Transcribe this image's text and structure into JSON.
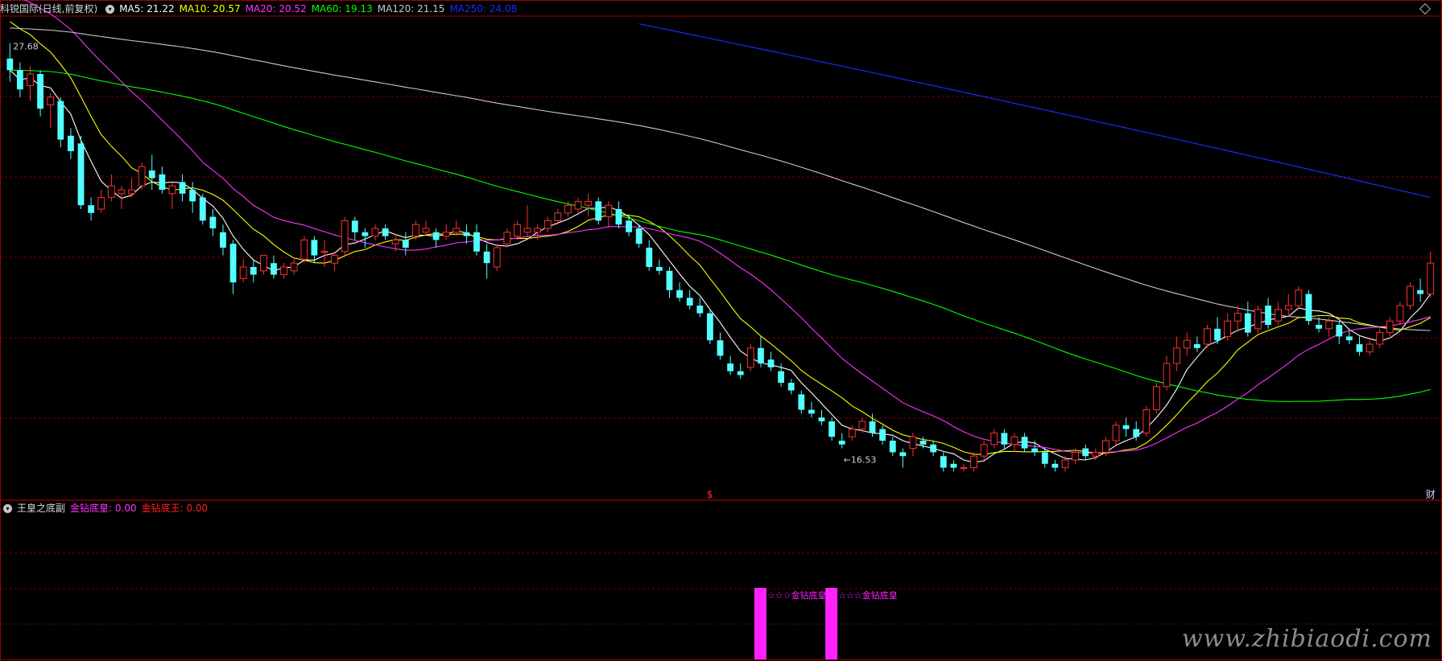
{
  "main_header": {
    "title": "科锐国际(日线,前复权)",
    "ma_labels": [
      {
        "text": "MA5: 21.22",
        "color": "#ffffff"
      },
      {
        "text": "MA10: 20.57",
        "color": "#ffff00"
      },
      {
        "text": "MA20: 20.52",
        "color": "#ff33ff"
      },
      {
        "text": "MA60: 19.13",
        "color": "#00ff00"
      },
      {
        "text": "MA120: 21.15",
        "color": "#c8c8c8"
      },
      {
        "text": "MA250: 24.08",
        "color": "#1a2cff"
      }
    ]
  },
  "sub_header": {
    "title": "王皇之底副",
    "items": [
      {
        "text": "金钻底皇: 0.00",
        "color": "#ff33ff"
      },
      {
        "text": "金钻底王: 0.00",
        "color": "#ff2020"
      }
    ]
  },
  "annotations": {
    "high_label": "27.68",
    "low_label": "←16.53",
    "marker_s": "$",
    "marker_cai": "财",
    "signal_label_1": "☆☆☆金钻底皇",
    "signal_label_2": "☆☆☆金钻底皇"
  },
  "watermark": "www.zhibiaodi.com",
  "colors": {
    "up": "#ff3030",
    "down": "#54ffff",
    "grid": "#7a0000",
    "border": "#a00000",
    "ma5": "#ffffff",
    "ma10": "#ffff00",
    "ma20": "#ff33ff",
    "ma60": "#00ff00",
    "ma120": "#c8c8c8",
    "ma250": "#1a2cff",
    "signal": "#ff22ff"
  },
  "chart_data": {
    "type": "candlestick",
    "title": "科锐国际(日线,前复权)",
    "price_range": [
      15.8,
      28.3
    ],
    "high": 27.68,
    "low": 16.53,
    "candles": [
      [
        27.2,
        27.6,
        26.6,
        26.9
      ],
      [
        26.9,
        27.1,
        26.2,
        26.4
      ],
      [
        26.5,
        27.0,
        26.1,
        26.8
      ],
      [
        26.8,
        26.9,
        25.7,
        25.9
      ],
      [
        26.0,
        26.3,
        25.4,
        26.2
      ],
      [
        26.1,
        26.2,
        24.9,
        25.1
      ],
      [
        25.2,
        25.4,
        24.6,
        24.8
      ],
      [
        25.0,
        25.2,
        23.3,
        23.4
      ],
      [
        23.4,
        23.6,
        23.0,
        23.2
      ],
      [
        23.3,
        23.8,
        23.2,
        23.6
      ],
      [
        23.6,
        24.2,
        23.5,
        23.9
      ],
      [
        23.7,
        23.9,
        23.3,
        23.8
      ],
      [
        23.7,
        24.1,
        23.6,
        23.8
      ],
      [
        23.9,
        24.5,
        23.8,
        24.4
      ],
      [
        24.3,
        24.7,
        23.8,
        24.1
      ],
      [
        24.2,
        24.4,
        23.7,
        23.8
      ],
      [
        23.7,
        24.0,
        23.3,
        23.9
      ],
      [
        24.0,
        24.2,
        23.5,
        23.7
      ],
      [
        23.8,
        24.0,
        23.2,
        23.5
      ],
      [
        23.6,
        23.7,
        22.9,
        23.0
      ],
      [
        23.1,
        23.3,
        22.6,
        22.8
      ],
      [
        22.7,
        22.9,
        22.1,
        22.3
      ],
      [
        22.4,
        22.5,
        21.1,
        21.4
      ],
      [
        21.5,
        22.0,
        21.4,
        21.8
      ],
      [
        21.8,
        22.0,
        21.4,
        21.6
      ],
      [
        21.7,
        22.1,
        21.6,
        22.1
      ],
      [
        21.9,
        22.1,
        21.5,
        21.6
      ],
      [
        21.6,
        21.9,
        21.5,
        21.8
      ],
      [
        21.7,
        22.0,
        21.6,
        21.9
      ],
      [
        22.0,
        22.6,
        21.9,
        22.5
      ],
      [
        22.5,
        22.6,
        21.9,
        22.1
      ],
      [
        22.2,
        22.5,
        21.8,
        22.2
      ],
      [
        21.9,
        22.2,
        21.7,
        22.1
      ],
      [
        22.2,
        23.1,
        22.1,
        23.0
      ],
      [
        23.0,
        23.1,
        22.5,
        22.7
      ],
      [
        22.7,
        22.8,
        22.3,
        22.6
      ],
      [
        22.6,
        22.9,
        22.5,
        22.8
      ],
      [
        22.8,
        22.9,
        22.5,
        22.6
      ],
      [
        22.4,
        22.6,
        22.2,
        22.5
      ],
      [
        22.5,
        22.7,
        22.1,
        22.3
      ],
      [
        22.6,
        23.0,
        22.5,
        22.9
      ],
      [
        22.7,
        23.0,
        22.6,
        22.8
      ],
      [
        22.7,
        22.8,
        22.3,
        22.5
      ],
      [
        22.6,
        22.9,
        22.5,
        22.7
      ],
      [
        22.7,
        23.0,
        22.6,
        22.8
      ],
      [
        22.7,
        22.9,
        22.4,
        22.6
      ],
      [
        22.7,
        22.9,
        22.1,
        22.2
      ],
      [
        22.2,
        22.4,
        21.5,
        21.9
      ],
      [
        21.8,
        22.4,
        21.7,
        22.3
      ],
      [
        22.4,
        22.8,
        22.3,
        22.7
      ],
      [
        22.6,
        23.0,
        22.5,
        22.9
      ],
      [
        22.7,
        23.4,
        22.6,
        22.8
      ],
      [
        22.7,
        22.9,
        22.5,
        22.8
      ],
      [
        22.8,
        23.1,
        22.7,
        23.0
      ],
      [
        23.0,
        23.3,
        22.9,
        23.2
      ],
      [
        23.2,
        23.5,
        23.1,
        23.4
      ],
      [
        23.3,
        23.6,
        23.2,
        23.5
      ],
      [
        23.4,
        23.7,
        23.1,
        23.5
      ],
      [
        23.5,
        23.6,
        22.9,
        23.0
      ],
      [
        23.1,
        23.5,
        22.8,
        23.4
      ],
      [
        23.3,
        23.5,
        22.8,
        22.9
      ],
      [
        23.0,
        23.1,
        22.6,
        22.7
      ],
      [
        22.8,
        22.9,
        22.3,
        22.4
      ],
      [
        22.3,
        22.5,
        21.7,
        21.8
      ],
      [
        21.8,
        22.0,
        21.6,
        21.7
      ],
      [
        21.7,
        21.8,
        21.0,
        21.2
      ],
      [
        21.2,
        21.4,
        20.9,
        21.0
      ],
      [
        21.0,
        21.2,
        20.7,
        20.8
      ],
      [
        20.8,
        21.0,
        20.5,
        20.6
      ],
      [
        20.6,
        20.7,
        19.8,
        19.9
      ],
      [
        19.9,
        20.1,
        19.4,
        19.5
      ],
      [
        19.3,
        19.5,
        19.0,
        19.1
      ],
      [
        19.1,
        19.3,
        18.9,
        19.0
      ],
      [
        19.2,
        19.8,
        19.1,
        19.7
      ],
      [
        19.7,
        20.0,
        19.2,
        19.3
      ],
      [
        19.4,
        19.6,
        19.1,
        19.2
      ],
      [
        19.1,
        19.3,
        18.7,
        18.8
      ],
      [
        18.8,
        18.9,
        18.5,
        18.6
      ],
      [
        18.5,
        18.6,
        18.0,
        18.1
      ],
      [
        18.1,
        18.3,
        17.9,
        18.0
      ],
      [
        17.9,
        18.1,
        17.7,
        17.8
      ],
      [
        17.8,
        17.9,
        17.3,
        17.4
      ],
      [
        17.3,
        17.5,
        17.1,
        17.2
      ],
      [
        17.4,
        17.7,
        17.3,
        17.6
      ],
      [
        17.6,
        17.9,
        17.5,
        17.8
      ],
      [
        17.8,
        18.0,
        17.4,
        17.5
      ],
      [
        17.6,
        17.7,
        17.2,
        17.3
      ],
      [
        17.3,
        17.4,
        16.9,
        17.0
      ],
      [
        17.0,
        17.1,
        16.6,
        16.9
      ],
      [
        17.1,
        17.5,
        16.9,
        17.4
      ],
      [
        17.3,
        17.4,
        17.1,
        17.2
      ],
      [
        17.2,
        17.3,
        16.9,
        17.0
      ],
      [
        16.9,
        17.0,
        16.5,
        16.6
      ],
      [
        16.7,
        16.8,
        16.5,
        16.6
      ],
      [
        16.6,
        16.7,
        16.5,
        16.6
      ],
      [
        16.6,
        17.0,
        16.5,
        16.9
      ],
      [
        16.9,
        17.3,
        16.8,
        17.2
      ],
      [
        17.2,
        17.6,
        17.1,
        17.5
      ],
      [
        17.5,
        17.6,
        17.1,
        17.2
      ],
      [
        17.2,
        17.5,
        17.0,
        17.4
      ],
      [
        17.4,
        17.5,
        17.0,
        17.1
      ],
      [
        17.1,
        17.3,
        16.9,
        17.0
      ],
      [
        17.0,
        17.1,
        16.6,
        16.7
      ],
      [
        16.7,
        16.8,
        16.5,
        16.6
      ],
      [
        16.6,
        16.9,
        16.5,
        16.8
      ],
      [
        16.8,
        17.1,
        16.7,
        17.0
      ],
      [
        17.1,
        17.2,
        16.8,
        16.9
      ],
      [
        16.9,
        17.1,
        16.8,
        17.0
      ],
      [
        17.0,
        17.4,
        16.9,
        17.3
      ],
      [
        17.3,
        17.8,
        17.2,
        17.7
      ],
      [
        17.7,
        17.9,
        17.4,
        17.6
      ],
      [
        17.6,
        17.8,
        17.3,
        17.4
      ],
      [
        17.5,
        18.2,
        17.4,
        18.1
      ],
      [
        18.1,
        18.8,
        18.0,
        18.7
      ],
      [
        18.7,
        19.5,
        18.6,
        19.3
      ],
      [
        19.3,
        20.0,
        19.1,
        19.7
      ],
      [
        19.7,
        20.1,
        19.5,
        19.9
      ],
      [
        19.8,
        20.0,
        19.6,
        19.7
      ],
      [
        19.8,
        20.3,
        19.7,
        20.2
      ],
      [
        20.2,
        20.5,
        19.8,
        19.9
      ],
      [
        20.0,
        20.6,
        19.9,
        20.4
      ],
      [
        20.4,
        20.8,
        20.1,
        20.6
      ],
      [
        20.6,
        20.9,
        20.0,
        20.1
      ],
      [
        20.2,
        20.8,
        20.1,
        20.7
      ],
      [
        20.8,
        21.0,
        20.2,
        20.3
      ],
      [
        20.4,
        20.9,
        20.3,
        20.7
      ],
      [
        20.7,
        21.1,
        20.5,
        20.8
      ],
      [
        20.8,
        21.3,
        20.7,
        21.2
      ],
      [
        21.1,
        21.2,
        20.3,
        20.4
      ],
      [
        20.3,
        20.5,
        20.1,
        20.2
      ],
      [
        20.2,
        20.5,
        20.0,
        20.4
      ],
      [
        20.3,
        20.4,
        19.8,
        20.0
      ],
      [
        20.0,
        20.2,
        19.8,
        19.9
      ],
      [
        19.8,
        20.0,
        19.5,
        19.6
      ],
      [
        19.6,
        19.9,
        19.5,
        19.8
      ],
      [
        19.8,
        20.2,
        19.7,
        20.1
      ],
      [
        20.1,
        20.5,
        20.0,
        20.4
      ],
      [
        20.4,
        20.9,
        20.3,
        20.8
      ],
      [
        20.8,
        21.4,
        20.7,
        21.3
      ],
      [
        21.2,
        21.5,
        20.9,
        21.1
      ],
      [
        21.1,
        22.2,
        21.0,
        21.9
      ]
    ],
    "signals_at_candle": [
      74,
      81
    ],
    "high_at_candle": 0,
    "low_at_candle": 82,
    "marker_s_at_candle": 69,
    "marker_cai_at_candle": 140
  }
}
